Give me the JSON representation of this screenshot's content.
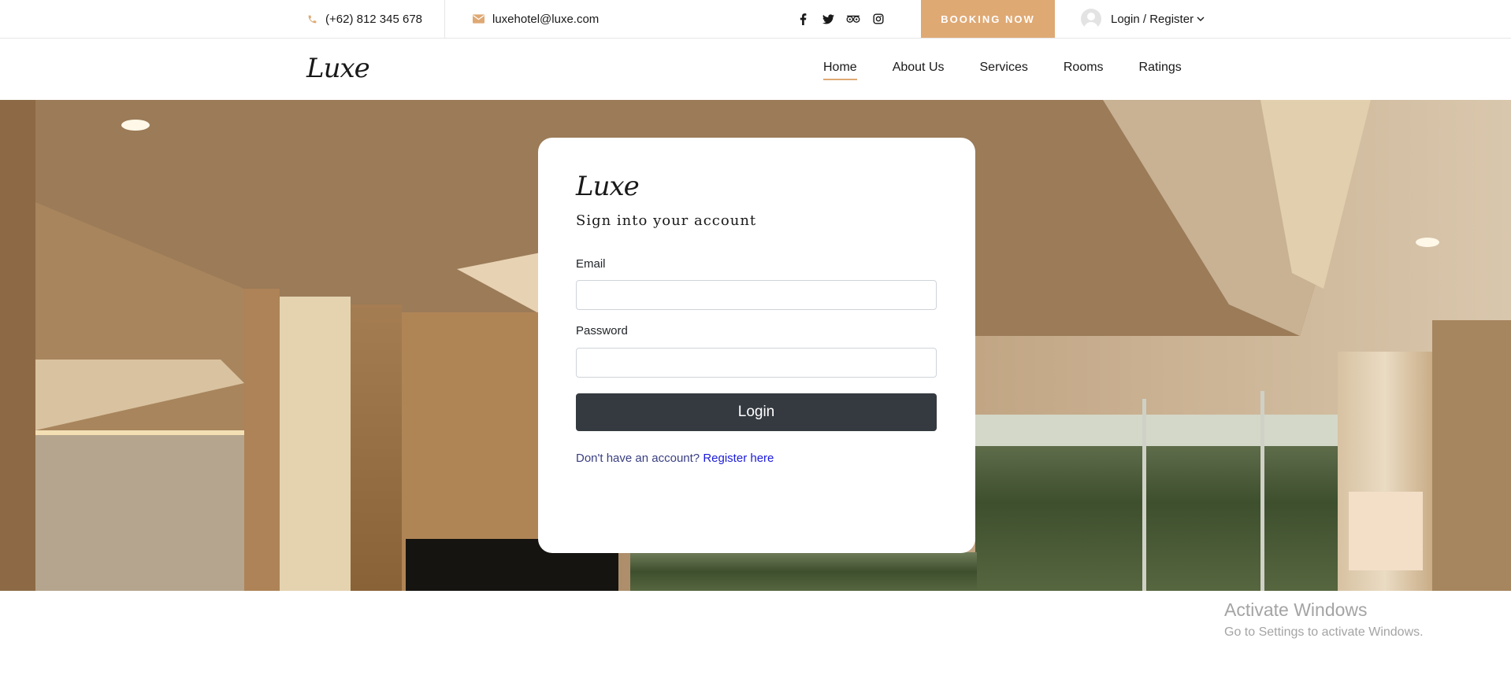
{
  "topbar": {
    "phone": "(+62) 812 345 678",
    "email": "luxehotel@luxe.com",
    "social_icons": [
      "facebook-icon",
      "twitter-icon",
      "tripadvisor-icon",
      "instagram-icon"
    ],
    "booking_label": "BOOKING NOW",
    "account_label": "Login / Register"
  },
  "navbar": {
    "logo": "Luxe",
    "menu": [
      "Home",
      "About Us",
      "Services",
      "Rooms",
      "Ratings"
    ],
    "active": "Home"
  },
  "login": {
    "logo": "Luxe",
    "subtitle": "Sign into your account",
    "email_label": "Email",
    "email_value": "",
    "password_label": "Password",
    "password_value": "",
    "button_label": "Login",
    "register_prompt": "Don't have an account?",
    "register_link": "Register here"
  },
  "watermark": {
    "title": "Activate Windows",
    "subtitle": "Go to Settings to activate Windows."
  },
  "colors": {
    "accent": "#dfa974",
    "button_dark": "#343a40",
    "link": "#1a1adb"
  }
}
